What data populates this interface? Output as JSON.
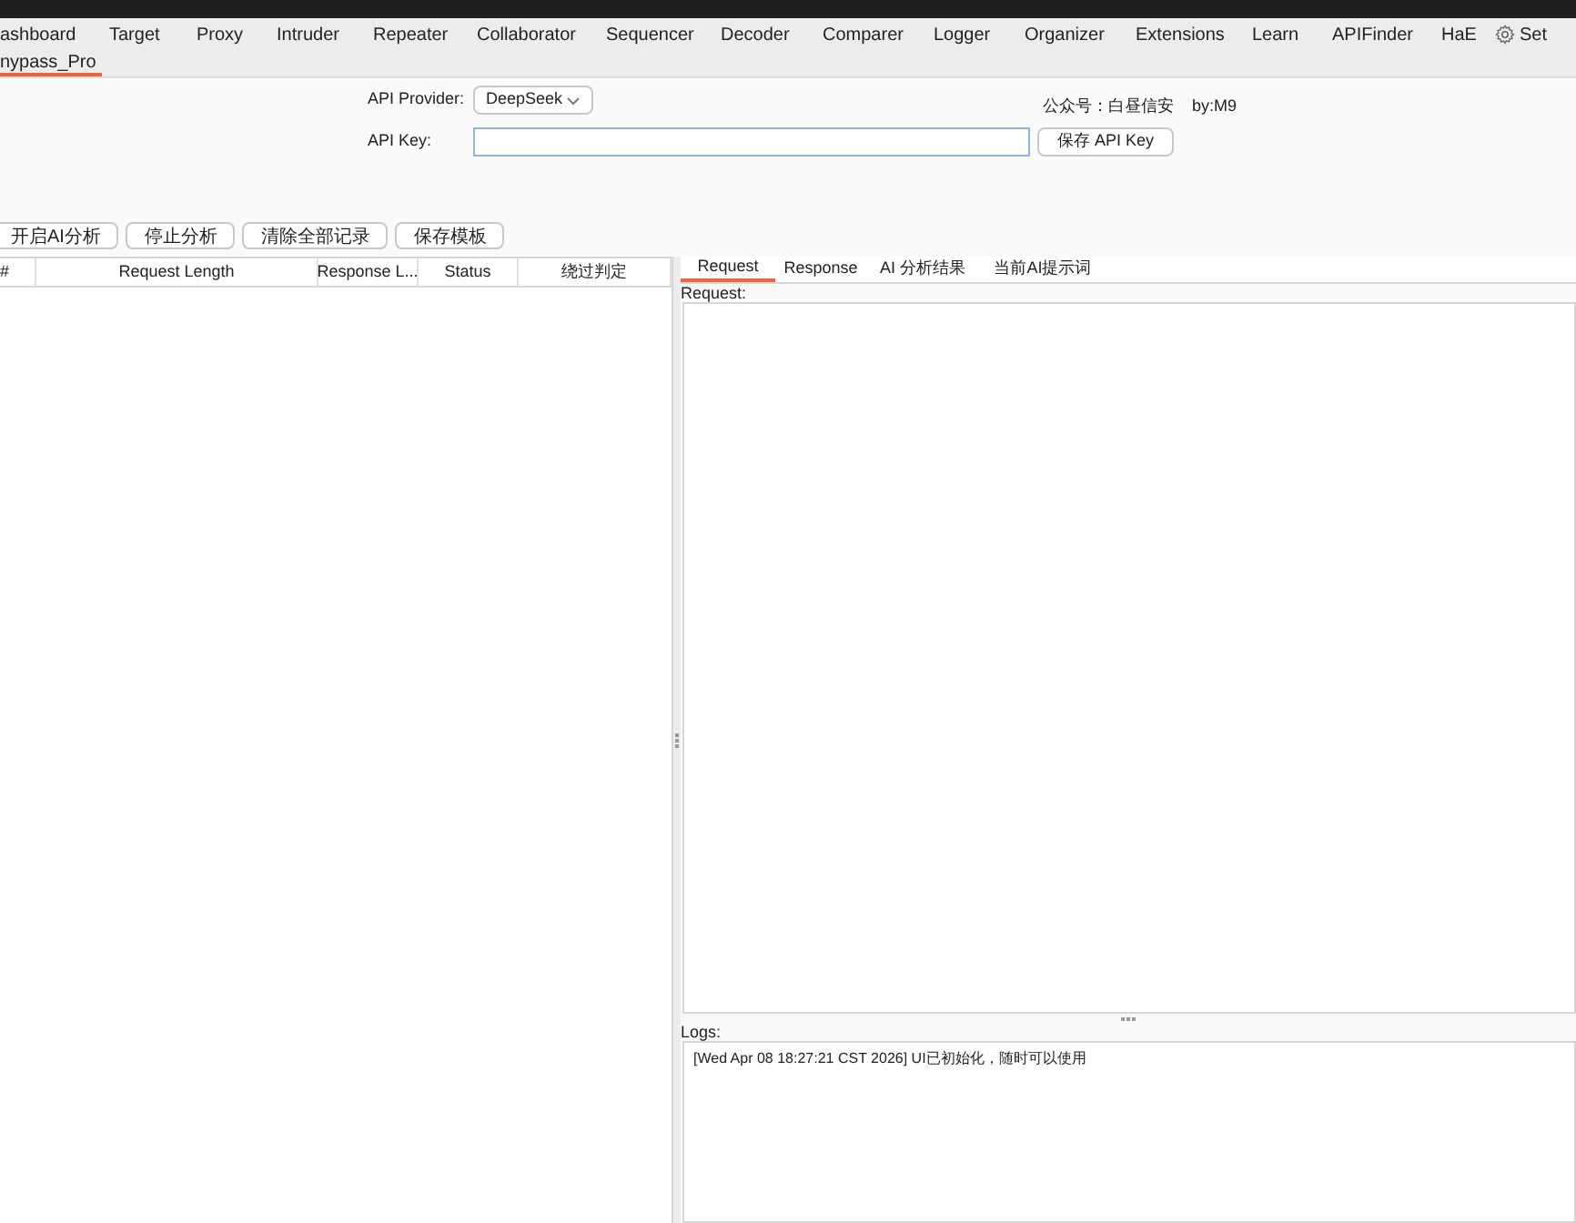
{
  "main_tabs": [
    {
      "label": "ashboard",
      "selected": false
    },
    {
      "label": "Target",
      "selected": false
    },
    {
      "label": "Proxy",
      "selected": false
    },
    {
      "label": "Intruder",
      "selected": false
    },
    {
      "label": "Repeater",
      "selected": false
    },
    {
      "label": "Collaborator",
      "selected": false
    },
    {
      "label": "Sequencer",
      "selected": false
    },
    {
      "label": "Decoder",
      "selected": false
    },
    {
      "label": "Comparer",
      "selected": false
    },
    {
      "label": "Logger",
      "selected": false
    },
    {
      "label": "Organizer",
      "selected": false
    },
    {
      "label": "Extensions",
      "selected": false
    },
    {
      "label": "Learn",
      "selected": false
    },
    {
      "label": "APIFinder",
      "selected": false
    },
    {
      "label": "HaE",
      "selected": false
    }
  ],
  "settings_label": "Set",
  "sub_tabs": [
    {
      "label": "nypass_Pro",
      "selected": true
    }
  ],
  "config": {
    "provider_label": "API Provider:",
    "provider_value": "DeepSeek",
    "key_label": "API Key:",
    "credit": "公众号：白昼信安",
    "author": "by:M9",
    "save_key_button": "保存 API Key"
  },
  "actions": [
    "开启AI分析",
    "停止分析",
    "清除全部记录",
    "保存模板"
  ],
  "table": {
    "columns": [
      "#",
      "Request Length",
      "Response L...",
      "Status",
      "绕过判定"
    ]
  },
  "detail_tabs": [
    {
      "label": "Request",
      "selected": true
    },
    {
      "label": "Response",
      "selected": false
    },
    {
      "label": "AI 分析结果",
      "selected": false
    },
    {
      "label": "当前AI提示词",
      "selected": false
    }
  ],
  "request_label": "Request:",
  "logs_label": "Logs:",
  "logs": [
    "[Wed Apr 08 18:27:21 CST 2026] UI已初始化，随时可以使用"
  ]
}
